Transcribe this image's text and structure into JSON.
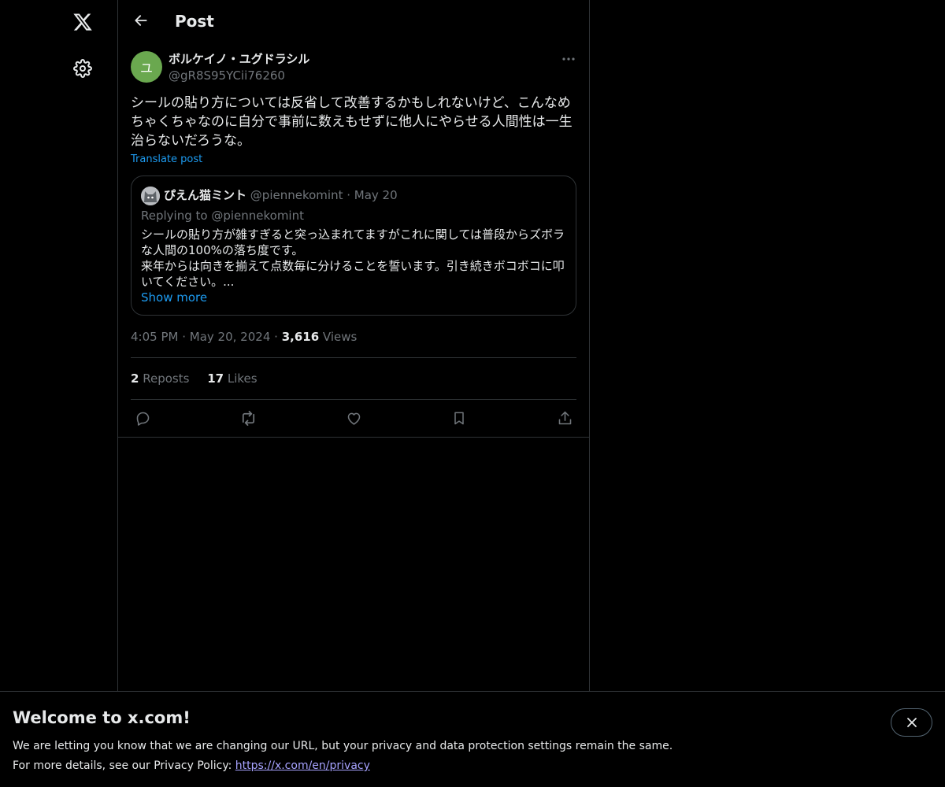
{
  "nav": {
    "logo_icon": "x-logo-icon",
    "settings_icon": "gear-icon"
  },
  "header": {
    "title": "Post"
  },
  "post": {
    "avatar_letter": "ユ",
    "avatar_color": "#6aa84f",
    "author_name": "ボルケイノ・ユグドラシル",
    "author_handle": "@gR8S95YCii76260",
    "text": "シールの貼り方については反省して改善するかもしれないけど、こんなめ\nちゃくちゃなのに自分で事前に数えもせずに他人にやらせる人間性は一生\n治らないだろうな。",
    "translate_label": "Translate post",
    "time": "4:05 PM",
    "date": "May 20, 2024",
    "views_count": "3,616",
    "views_label": "Views",
    "reposts_count": "2",
    "reposts_label": "Reposts",
    "likes_count": "17",
    "likes_label": "Likes"
  },
  "quote": {
    "name": "ぴえん猫ミント",
    "handle": "@piennekomint",
    "date": "May 20",
    "replying_to": "Replying to @piennekomint",
    "text": "シールの貼り方が雑すぎると突っ込まれてますがこれに関しては普段からズボラ\nな人間の100%の落ち度です。\n来年からは向きを揃えて点数毎に分けることを誓います。引き続きボコボコに叩\nいてください。...",
    "show_more": "Show more"
  },
  "actions": [
    "reply-icon",
    "repost-icon",
    "like-icon",
    "bookmark-icon",
    "share-icon"
  ],
  "banner": {
    "title": "Welcome to x.com!",
    "line1": "We are letting you know that we are changing our URL, but your privacy and data protection settings remain the same.",
    "line2_prefix": "For more details, see our Privacy Policy: ",
    "link": "https://x.com/en/privacy"
  },
  "colors": {
    "background": "#000000",
    "text_primary": "#e7e9ea",
    "text_secondary": "#71767b",
    "accent": "#1d9bf0",
    "border": "#2f3336"
  }
}
